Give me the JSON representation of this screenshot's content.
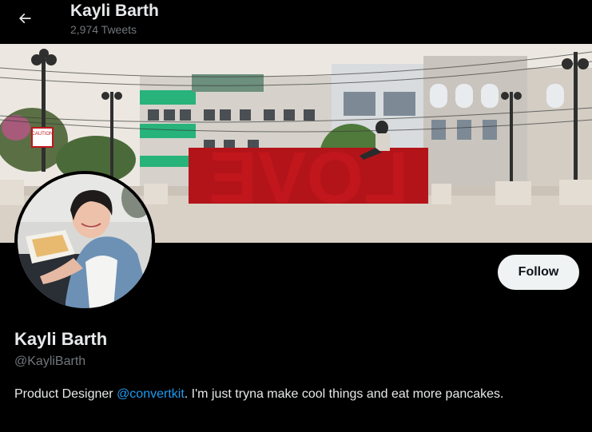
{
  "header": {
    "name": "Kayli Barth",
    "tweet_count": "2,974 Tweets"
  },
  "profile": {
    "name": "Kayli Barth",
    "handle": "@KayliBarth",
    "bio_before": "Product Designer ",
    "bio_mention": "@convertkit",
    "bio_after": ". I'm just tryna make cool things and eat more pancakes.",
    "follow_label": "Follow"
  },
  "banner": {
    "sign_text": "LOVE",
    "caution_label": "CAUTION"
  },
  "colors": {
    "background": "#000000",
    "text_primary": "#e7e9ea",
    "text_secondary": "#71767b",
    "link": "#1d9bf0",
    "follow_bg": "#eff3f4",
    "love_red": "#c0161c"
  },
  "icons": {
    "back": "back-arrow-icon"
  }
}
